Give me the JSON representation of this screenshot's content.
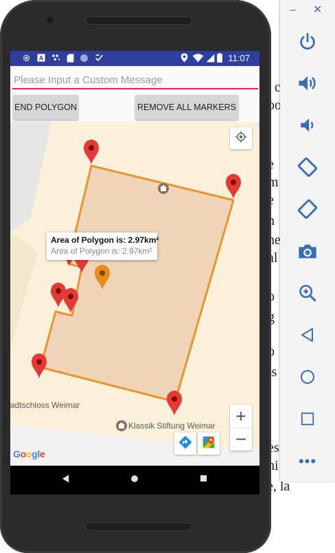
{
  "status_bar": {
    "time": "11:07",
    "left_icons": [
      "gear-icon",
      "a-icon",
      "dots-icon",
      "sd-card-icon",
      "circle-icon",
      "check-icon"
    ],
    "right_icons": [
      "location-pin-icon",
      "wifi-icon",
      "signal-icon",
      "battery-icon"
    ]
  },
  "message_input": {
    "placeholder": "Please Input a Custom Message",
    "value": ""
  },
  "buttons": {
    "end_polygon": "END POLYGON",
    "remove_markers": "REMOVE ALL MARKERS"
  },
  "map": {
    "info_window": {
      "title": "Area of Polygon is: 2.97km²",
      "snippet": "Area of Polygon is: 2.97km²"
    },
    "labels": {
      "schloss": "adtschloss Weimar",
      "klassik": "Klassik Stiftung Weimar"
    },
    "google_logo": "Google",
    "colors": {
      "polygon_stroke": "#e8952f",
      "polygon_fill": "#eed2b5",
      "marker_red": "#e53935",
      "marker_selected": "#ea8a1e",
      "map_bg": "#fdf0db"
    },
    "marker_count": 9
  },
  "nav_bar": {
    "buttons": [
      "back-icon",
      "home-icon",
      "recents-icon"
    ]
  },
  "emulator_panel": {
    "minimize": "–",
    "close": "✕",
    "more": "•••",
    "buttons": [
      "power-icon",
      "volume-up-icon",
      "volume-down-icon",
      "rotate-left-icon",
      "rotate-right-icon",
      "camera-icon",
      "zoom-icon",
      "back-icon",
      "home-icon",
      "overview-icon"
    ]
  },
  "background_doc": {
    "fragments": [
      "c",
      "oo",
      "e",
      "m",
      "e",
      "n",
      "ne",
      "al",
      "o",
      "g",
      "o",
      "ts",
      "es",
      "hi",
      "t name, la"
    ]
  }
}
